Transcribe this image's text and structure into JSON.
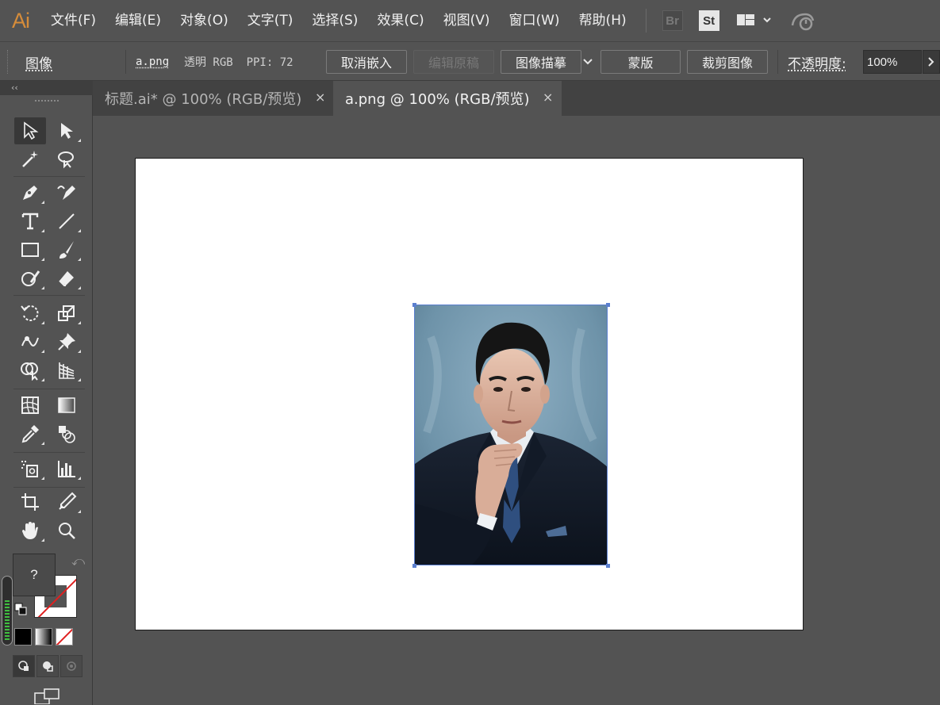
{
  "app": {
    "logo": "Ai"
  },
  "menu": [
    "文件(F)",
    "编辑(E)",
    "对象(O)",
    "文字(T)",
    "选择(S)",
    "效果(C)",
    "视图(V)",
    "窗口(W)",
    "帮助(H)"
  ],
  "menubar_icons": {
    "bridge": "Br",
    "stock": "St",
    "workspace": "workspace-layout-icon",
    "sync": "sync-icon"
  },
  "control": {
    "object_type": "图像",
    "file_name": "a.png",
    "info": "透明 RGB  PPI: 72",
    "unembed": "取消嵌入",
    "edit_original": "编辑原稿",
    "image_trace": "图像描摹",
    "mask": "蒙版",
    "crop_image": "裁剪图像",
    "opacity_label": "不透明度:",
    "opacity_value": "100%"
  },
  "toolbar": {
    "collapse": "‹‹",
    "fill_label": "?"
  },
  "tabs": [
    {
      "label": "标题.ai* @ 100% (RGB/预览)",
      "active": false
    },
    {
      "label": "a.png @ 100% (RGB/预览)",
      "active": true
    }
  ],
  "tab_close": "×",
  "colors": {
    "accent": "#d58c3a",
    "selection": "#5b7fcf",
    "background": "#535353",
    "artboard": "#ffffff"
  }
}
